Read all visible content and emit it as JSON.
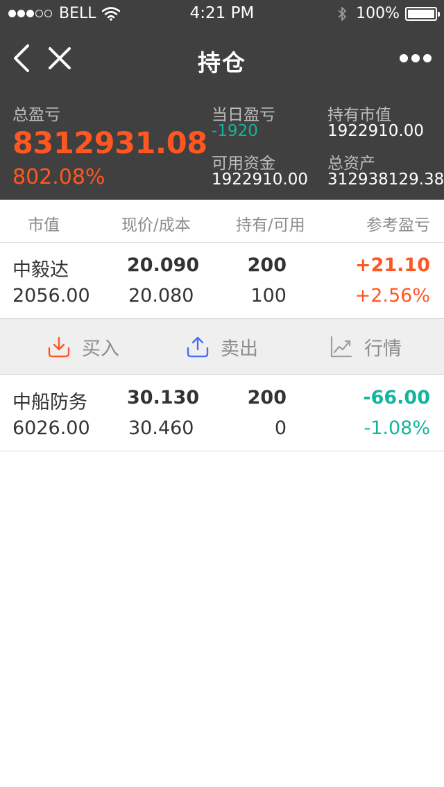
{
  "status_bar": {
    "carrier": "BELL",
    "time": "4:21 PM",
    "battery": "100%",
    "icons": [
      "signal-icon",
      "wifi-icon",
      "bluetooth-icon",
      "battery-icon"
    ]
  },
  "nav": {
    "title": "持仓",
    "icons": [
      "back-icon",
      "close-icon",
      "more-icon"
    ]
  },
  "summary": {
    "total_pl_label": "总盈亏",
    "total_pl_value": "8312931.08",
    "total_pl_pct": "802.08%",
    "daily_pl_label": "当日盈亏",
    "daily_pl_value": "-1920",
    "market_value_label": "持有市值",
    "market_value_value": "1922910.00",
    "available_funds_label": "可用资金",
    "available_funds_value": "1922910.00",
    "total_assets_label": "总资产",
    "total_assets_value": "312938129.38"
  },
  "table": {
    "headers": [
      "市值",
      "现价/成本",
      "持有/可用",
      "参考盈亏"
    ],
    "rows": [
      {
        "name": "中毅达",
        "market_value": "2056.00",
        "price": "20.090",
        "cost": "20.080",
        "hold": "200",
        "available": "100",
        "pl": "+21.10",
        "pl_pct": "+2.56%",
        "trend": "up"
      },
      {
        "name": "中船防务",
        "market_value": "6026.00",
        "price": "30.130",
        "cost": "30.460",
        "hold": "200",
        "available": "0",
        "pl": "-66.00",
        "pl_pct": "-1.08%",
        "trend": "down"
      }
    ]
  },
  "actions": {
    "buy": "买入",
    "sell": "卖出",
    "quote": "行情"
  },
  "colors": {
    "header_bg": "#404040",
    "profit": "#ff5722",
    "loss": "#13b59c",
    "sell_icon": "#4a6cf7"
  }
}
